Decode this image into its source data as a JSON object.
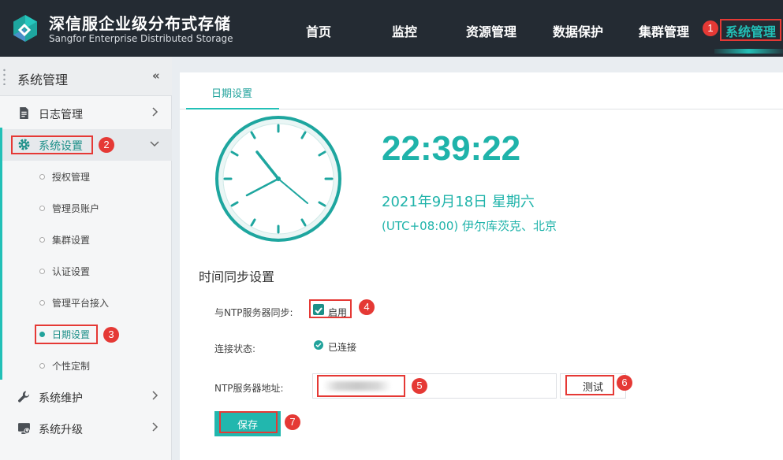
{
  "brand": {
    "title": "深信服企业级分布式存储",
    "subtitle": "Sangfor Enterprise Distributed Storage"
  },
  "nav": {
    "items": [
      "首页",
      "监控",
      "资源管理",
      "数据保护",
      "集群管理",
      "系统管理"
    ],
    "active_index": 5
  },
  "sidebar": {
    "title": "系统管理",
    "collapse_icon": "double-chevron-left-icon",
    "groups": [
      {
        "label": "日志管理",
        "icon": "document-icon",
        "expanded": false
      },
      {
        "label": "系统设置",
        "icon": "gear-icon",
        "expanded": true
      },
      {
        "label": "系统维护",
        "icon": "wrench-icon",
        "expanded": false
      },
      {
        "label": "系统升级",
        "icon": "upgrade-icon",
        "expanded": false
      }
    ],
    "sub_items": [
      "授权管理",
      "管理员账户",
      "集群设置",
      "认证设置",
      "管理平台接入",
      "日期设置",
      "个性定制"
    ],
    "active_sub_index": 5
  },
  "tab": {
    "label": "日期设置"
  },
  "clock": {
    "time": "22:39:22",
    "date": "2021年9月18日 星期六",
    "timezone": "(UTC+08:00) 伊尔库茨克、北京"
  },
  "sync": {
    "section_title": "时间同步设置",
    "ntp_sync_label": "与NTP服务器同步:",
    "enable_label": "启用",
    "enabled": true,
    "status_label": "连接状态:",
    "status_value": "已连接",
    "ntp_addr_label": "NTP服务器地址:",
    "ntp_addr_value": "",
    "test_label": "测试",
    "save_label": "保存"
  },
  "annotations": [
    "1",
    "2",
    "3",
    "4",
    "5",
    "6",
    "7"
  ],
  "colors": {
    "accent": "#22c0b7",
    "topbar": "#242b33",
    "annotation": "#e53935"
  }
}
